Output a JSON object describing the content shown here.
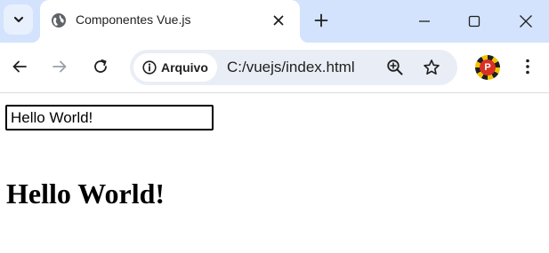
{
  "browser": {
    "tab": {
      "title": "Componentes Vue.js"
    },
    "omnibox": {
      "security_chip": "Arquivo",
      "url": "C:/vuejs/index.html"
    },
    "profile": {
      "initial": "P"
    },
    "icons": {
      "tab_search": "chevron-down-icon",
      "favicon": "globe-icon",
      "tab_close": "close-icon",
      "new_tab": "plus-icon",
      "minimize": "minimize-icon",
      "maximize": "maximize-icon",
      "window_close": "close-icon",
      "back": "arrow-left-icon",
      "forward": "arrow-right-icon",
      "reload": "reload-icon",
      "info": "info-icon",
      "zoom": "zoom-in-icon",
      "bookmark": "star-icon",
      "menu": "kebab-menu-icon"
    },
    "colors": {
      "tabstrip": "#d3e3fd",
      "omnibox": "#e9eef6",
      "forward_disabled": "#9aa0a6"
    }
  },
  "page": {
    "input_value": "Hello World!",
    "heading": "Hello World!"
  }
}
